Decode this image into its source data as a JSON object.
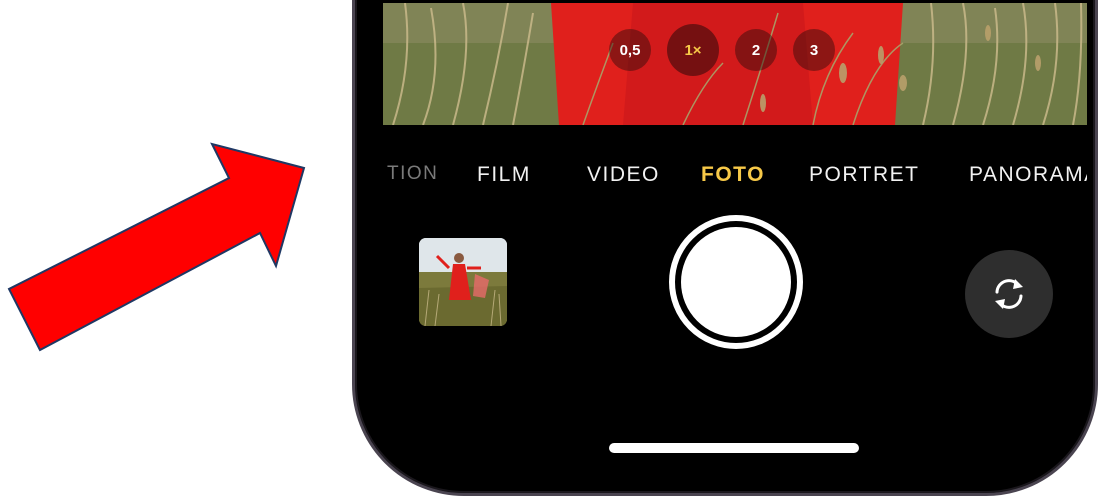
{
  "zoom_options": [
    {
      "label": "0,5",
      "active": false
    },
    {
      "label": "1×",
      "active": true
    },
    {
      "label": "2",
      "active": false
    },
    {
      "label": "3",
      "active": false
    }
  ],
  "modes": [
    {
      "label": "TION",
      "state": "faded"
    },
    {
      "label": "FILM",
      "state": "normal"
    },
    {
      "label": "VIDEO",
      "state": "normal"
    },
    {
      "label": "FOTO",
      "state": "active"
    },
    {
      "label": "PORTRET",
      "state": "normal"
    },
    {
      "label": "PANORAMA",
      "state": "normal"
    }
  ],
  "icons": {
    "annotation": "red-arrow",
    "thumbnail": "last-photo-thumbnail",
    "shutter": "shutter-button",
    "flip": "camera-flip-icon"
  },
  "colors": {
    "accent": "#f7c948",
    "arrow_fill": "#ff0000",
    "arrow_stroke": "#1f3864",
    "subject_red": "#e0201c",
    "background": "#000000",
    "phone_frame": "#4a4450"
  }
}
